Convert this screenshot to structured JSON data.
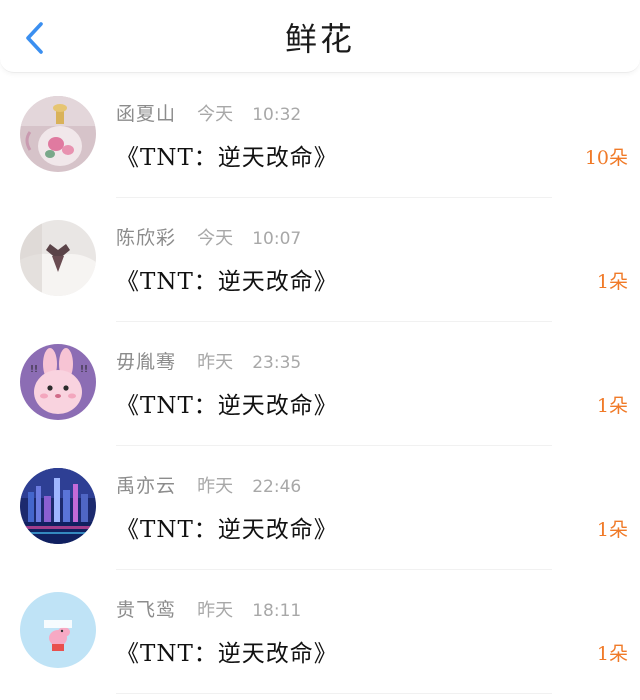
{
  "header": {
    "title": "鲜花"
  },
  "colors": {
    "back_arrow": "#3b8ff0",
    "count": "#f07a28"
  },
  "items": [
    {
      "name": "函夏山",
      "date": "今天",
      "time": "10:32",
      "book": "《TNT：逆天改命》",
      "count": "10朵",
      "avatar": "perfume-bottle"
    },
    {
      "name": "陈欣彩",
      "date": "今天",
      "time": "10:07",
      "book": "《TNT：逆天改命》",
      "count": "1朵",
      "avatar": "uniform-photo"
    },
    {
      "name": "毋胤骞",
      "date": "昨天",
      "time": "23:35",
      "book": "《TNT：逆天改命》",
      "count": "1朵",
      "avatar": "pink-bunny"
    },
    {
      "name": "禹亦云",
      "date": "昨天",
      "time": "22:46",
      "book": "《TNT：逆天改命》",
      "count": "1朵",
      "avatar": "city-night"
    },
    {
      "name": "贵飞鸾",
      "date": "昨天",
      "time": "18:11",
      "book": "《TNT：逆天改命》",
      "count": "1朵",
      "avatar": "peppa-pig"
    }
  ]
}
